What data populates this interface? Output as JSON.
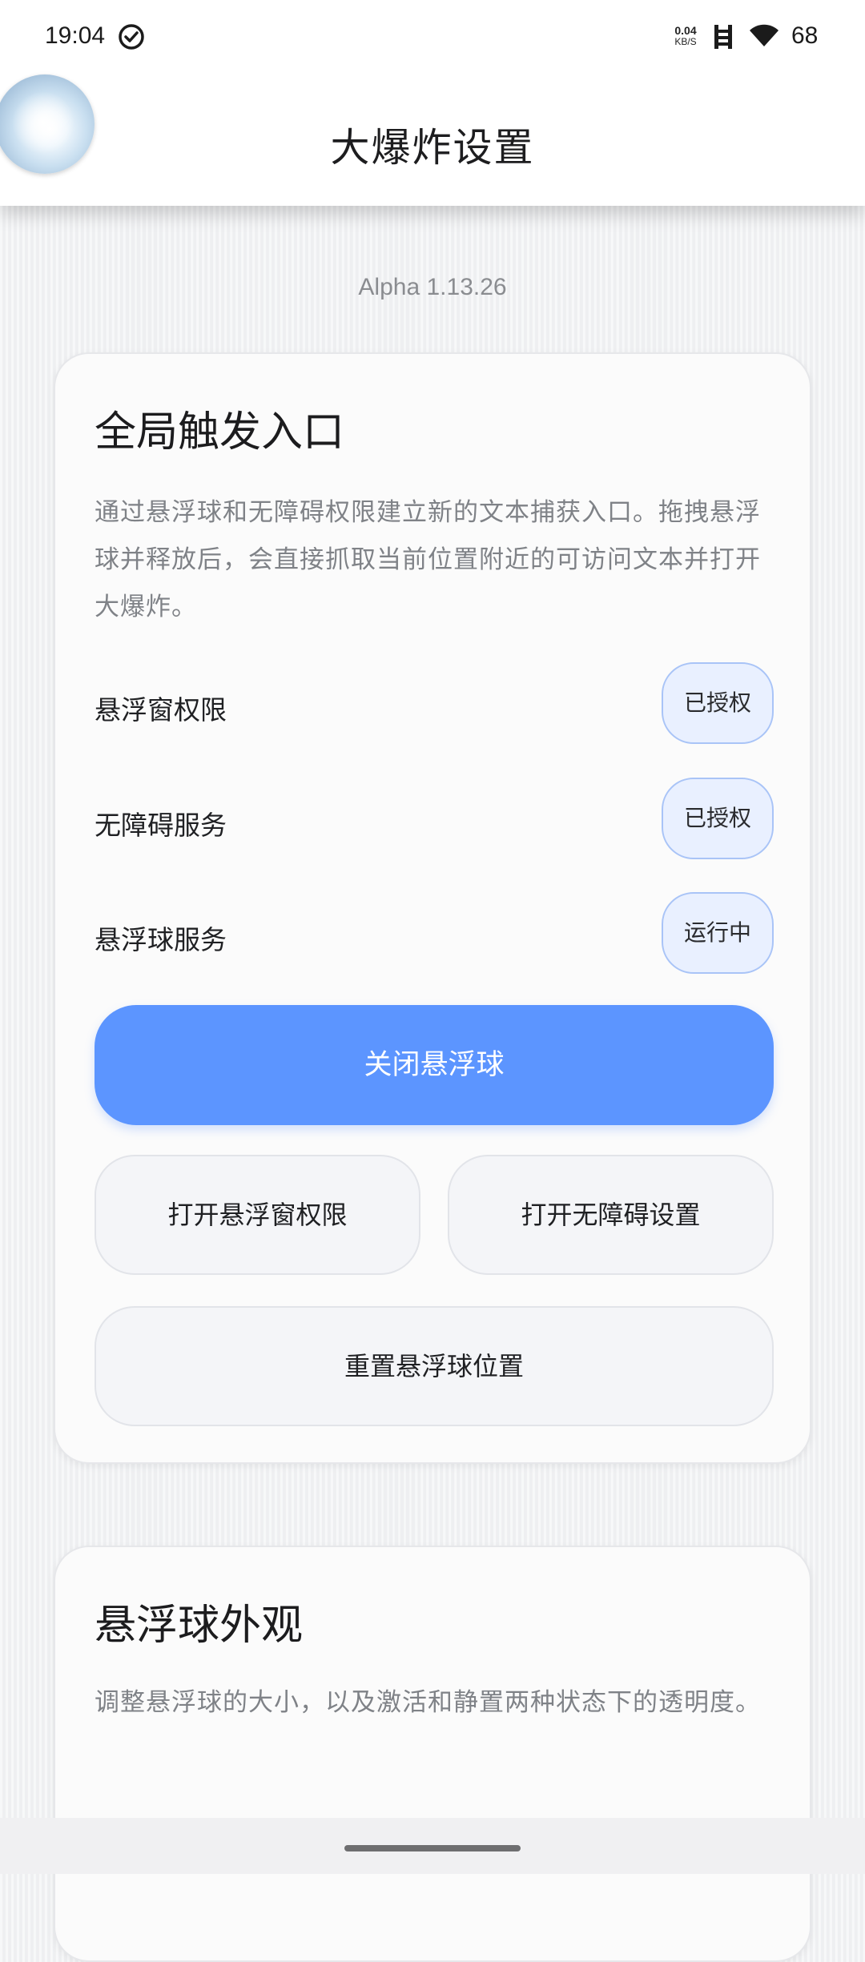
{
  "status_bar": {
    "time": "19:04",
    "net_speed_value": "0.04",
    "net_speed_unit": "KB/S",
    "battery": "68"
  },
  "app_bar": {
    "title": "大爆炸设置"
  },
  "version": "Alpha 1.13.26",
  "global_trigger": {
    "title": "全局触发入口",
    "description": "通过悬浮球和无障碍权限建立新的文本捕获入口。拖拽悬浮球并释放后，会直接抓取当前位置附近的可访问文本并打开大爆炸。",
    "permissions": [
      {
        "label": "悬浮窗权限",
        "status": "已授权"
      },
      {
        "label": "无障碍服务",
        "status": "已授权"
      },
      {
        "label": "悬浮球服务",
        "status": "运行中"
      }
    ],
    "close_ball_button": "关闭悬浮球",
    "open_overlay_button": "打开悬浮窗权限",
    "open_a11y_button": "打开无障碍设置",
    "reset_position_button": "重置悬浮球位置"
  },
  "ball_appearance": {
    "title": "悬浮球外观",
    "description": "调整悬浮球的大小，以及激活和静置两种状态下的透明度。"
  },
  "colors": {
    "accent": "#5c95ff",
    "badge_bg": "#e9f0ff",
    "badge_border": "#a9c4f7"
  }
}
